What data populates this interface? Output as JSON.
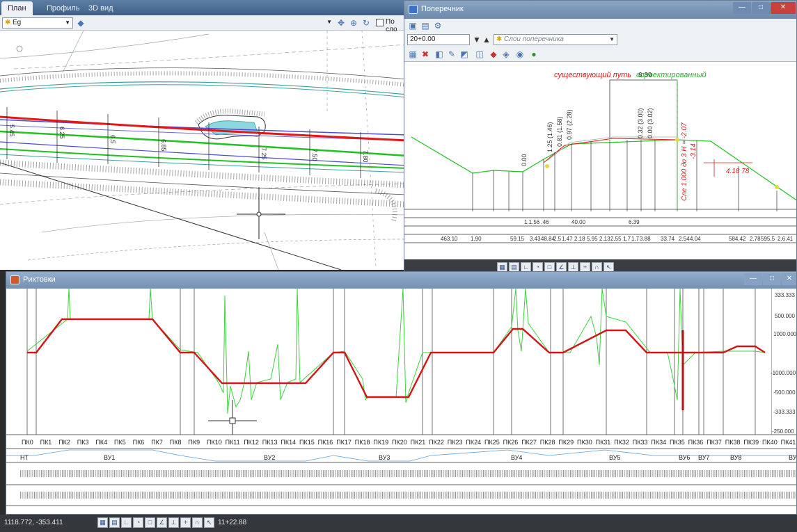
{
  "plan": {
    "tabs": [
      {
        "label": "План"
      },
      {
        "label": "Профиль"
      },
      {
        "label": "3D вид"
      }
    ],
    "layer_combo": "Eg",
    "toolbar_check_label": "По сло",
    "pickets": [
      "5.45",
      "6.25",
      "6.5",
      "6.85",
      "7.25",
      "7.50",
      "7.80"
    ]
  },
  "cross_section": {
    "title": "Поперечник",
    "station": "20+0.00",
    "layers_placeholder": "Слои поперечника",
    "label_existing": "существующий путь",
    "label_designed": "спроектированный",
    "dim_top": "6.39",
    "vert_labels": [
      "0.00",
      "1.25 (1.46)",
      "0.81 (1.58)",
      "0.97 (2.28)",
      "0.32 (3.00)",
      "0.00 (3.02)"
    ],
    "annotation_axis": "Сле 1.000 до 3 Н = -2.07",
    "annotation_sub": "-3.14",
    "annotation_right": "4.18 78",
    "row1": [
      "1.1.56 .46",
      "40.00",
      "6.39"
    ],
    "row2": [
      "463.10",
      "1.90",
      "59.15",
      "3.43",
      "48.84",
      "2.5",
      "1.47",
      "2.18",
      "5.95",
      "2.13",
      "2.55",
      "1.7",
      "1.7",
      "3.88",
      "33.74",
      "2.54",
      "4.04",
      "584.42",
      "2.78",
      "595.5",
      "2.6.41"
    ]
  },
  "rikhtovki": {
    "title": "Рихтовки",
    "scale_labels": [
      "333.333",
      "500.000",
      "1000.000",
      "-1000.000",
      "-500.000",
      "-333.333",
      "-250.000"
    ],
    "pk_labels": [
      "ПК0",
      "ПК1",
      "ПК2",
      "ПК3",
      "ПК4",
      "ПК5",
      "ПК6",
      "ПК7",
      "ПК8",
      "ПК9",
      "ПК10",
      "ПК11",
      "ПК12",
      "ПК13",
      "ПК14",
      "ПК15",
      "ПК16",
      "ПК17",
      "ПК18",
      "ПК19",
      "ПК20",
      "ПК21",
      "ПК22",
      "ПК23",
      "ПК24",
      "ПК25",
      "ПК26",
      "ПК27",
      "ПК28",
      "ПК29",
      "ПК30",
      "ПК31",
      "ПК32",
      "ПК33",
      "ПК34",
      "ПК35",
      "ПК36",
      "ПК37",
      "ПК38",
      "ПК39",
      "ПК40",
      "ПК41"
    ],
    "curve_labels": [
      "НТ",
      "ВУ1",
      "ВУ2",
      "ВУ3",
      "ВУ4",
      "ВУ5",
      "ВУ6",
      "ВУ7",
      "ВУ8",
      "ВУ"
    ]
  },
  "status": {
    "coords": "1118.772, -353.411",
    "station": "11+22.88"
  }
}
